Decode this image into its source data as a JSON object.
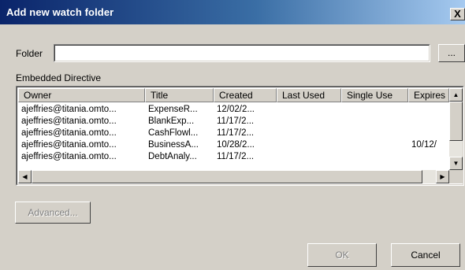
{
  "window": {
    "title": "Add new watch folder",
    "close_glyph": "X"
  },
  "folder": {
    "label": "Folder",
    "value": "",
    "browse_label": "..."
  },
  "directive": {
    "label": "Embedded Directive",
    "columns": [
      "Owner",
      "Title",
      "Created",
      "Last Used",
      "Single Use",
      "Expires"
    ],
    "rows": [
      [
        "ajeffries@titania.omto...",
        "ExpenseR...",
        "12/02/2...",
        "",
        "",
        ""
      ],
      [
        "ajeffries@titania.omto...",
        "BlankExp...",
        "11/17/2...",
        "",
        "",
        ""
      ],
      [
        "ajeffries@titania.omto...",
        "CashFlowl...",
        "11/17/2...",
        "",
        "",
        ""
      ],
      [
        "ajeffries@titania.omto...",
        "BusinessA...",
        "10/28/2...",
        "",
        "",
        "10/12/"
      ],
      [
        "ajeffries@titania.omto...",
        "DebtAnaly...",
        "11/17/2...",
        "",
        "",
        ""
      ]
    ]
  },
  "buttons": {
    "advanced": "Advanced...",
    "ok": "OK",
    "cancel": "Cancel"
  },
  "icons": {
    "scroll_up": "up-arrow-icon",
    "scroll_down": "down-arrow-icon",
    "scroll_left": "left-arrow-icon",
    "scroll_right": "right-arrow-icon"
  }
}
